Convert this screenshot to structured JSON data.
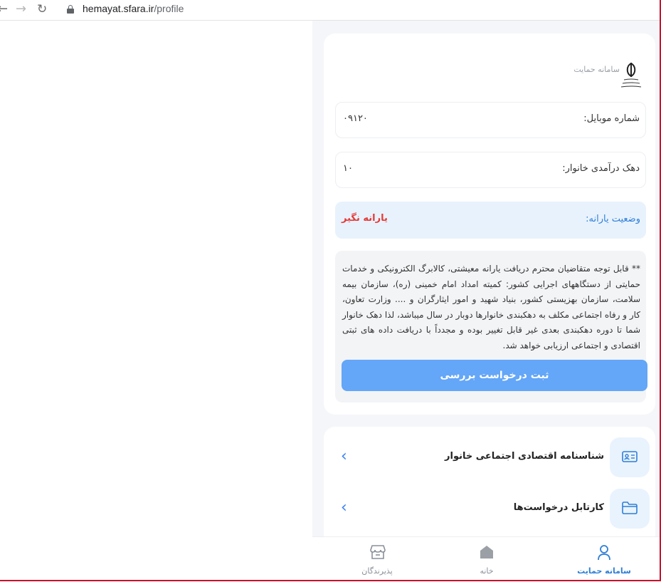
{
  "browser": {
    "url_host": "hemayat.sfara.ir",
    "url_path": "/profile"
  },
  "header": {
    "brand_title": "سامانه حمایت"
  },
  "form": {
    "mobile_label": "شماره موبایل:",
    "mobile_value": "۰۹۱۲۰",
    "decile_label": "دهک درآمدی خانوار:",
    "decile_value": "۱۰"
  },
  "subsidy": {
    "label": "وضعیت یارانه:",
    "value": "یارانه نگیر",
    "value_color": "#e53935"
  },
  "notice": {
    "text": "** قابل توجه متقاضیان محترم دریافت یارانه معیشتی، کالابرگ الکترونیکی و خدمات حمایتی از دستگاههای اجرایی کشور: کمیته امداد امام خمینی (ره)، سازمان بیمه سلامت، سازمان بهزیستی کشور، بنیاد شهید و امور ایثارگران و .... وزارت تعاون، کار و رفاه اجتماعی مکلف به دهکبندی خانوارها دوبار در سال میباشد، لذا دهک خانوار شما تا دوره دهکبندی بعدی غیر قابل تغییر بوده و مجدداً با دریافت داده های ثبتی اقتصادی و اجتماعی ارزیابی خواهد شد.",
    "button_label": "ثبت درخواست بررسی"
  },
  "menu": {
    "items": [
      {
        "label": "شناسنامه اقتصادی اجتماعی خانوار",
        "icon": "id-card-icon"
      },
      {
        "label": "کارتابل درخواست‌ها",
        "icon": "folder-icon"
      }
    ]
  },
  "bottom_nav": {
    "tabs": [
      {
        "label": "سامانه حمایت",
        "icon": "user-icon",
        "active": true
      },
      {
        "label": "خانه",
        "icon": "home-icon",
        "active": false
      },
      {
        "label": "پذیرندگان",
        "icon": "store-icon",
        "active": false
      }
    ]
  },
  "colors": {
    "accent": "#2f7fd6",
    "button": "#64a6f7",
    "status_bg": "#e8f2fd"
  }
}
